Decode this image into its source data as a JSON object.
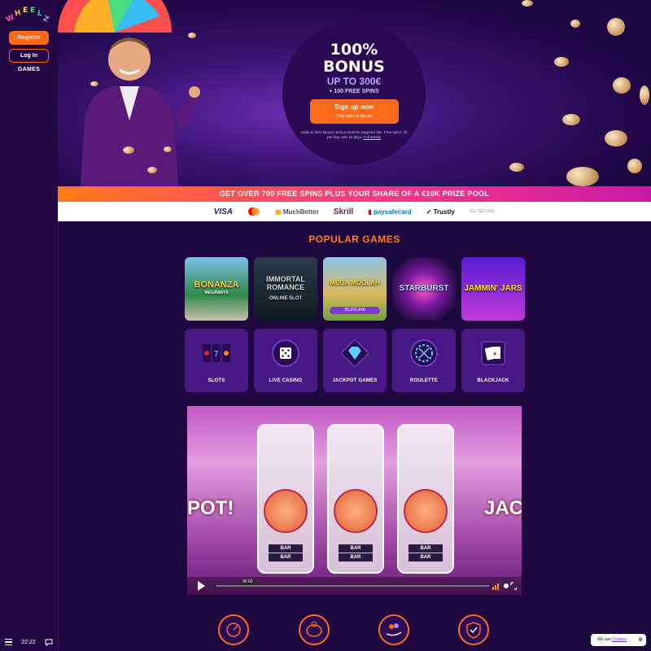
{
  "sidebar": {
    "register_label": "Register",
    "login_label": "Log In",
    "games_label": "GAMES",
    "time": "22:22"
  },
  "hero": {
    "bonus_title_line1": "100%",
    "bonus_title_line2": "BONUS",
    "bonus_up_to": "UP TO 300€",
    "free_spins": "+ 100 FREE SPINS",
    "signup_label": "Sign up now",
    "signup_sub": "Only takes a minute",
    "terms": "Valid on first deposit. Bonus must be wagered 35x. Free spins: 10 per day over 10 days.",
    "terms_link": "Full details"
  },
  "promo_banner": "GET OVER 700 FREE SPINS PLUS YOUR SHARE OF A €10K PRIZE POOL",
  "payments": [
    "VISA",
    "",
    "MuchBetter",
    "Skrill",
    "paysafecard",
    "Trustly",
    "SSL SECURE"
  ],
  "popular_games": {
    "title": "POPULAR GAMES",
    "games": [
      {
        "name": "BONANZA",
        "sub": "MEGAWAYS"
      },
      {
        "name": "IMMORTAL ROMANCE",
        "sub": "ONLINE SLOT"
      },
      {
        "name": "MEGA MOOLAH",
        "sub": "€5,252,440"
      },
      {
        "name": "STARBURST",
        "sub": ""
      },
      {
        "name": "JAMMIN' JARS",
        "sub": ""
      }
    ]
  },
  "categories": [
    {
      "label": "SLOTS",
      "icon": "slots-icon"
    },
    {
      "label": "LIVE CASINO",
      "icon": "dice-icon"
    },
    {
      "label": "JACKPOT GAMES",
      "icon": "diamond-icon"
    },
    {
      "label": "ROULETTE",
      "icon": "roulette-icon"
    },
    {
      "label": "BLACKJACK",
      "icon": "cards-icon"
    }
  ],
  "video": {
    "reel_label": "BAR",
    "left_label": "POT!",
    "right_label": "JAC",
    "time_display": "00:00"
  },
  "cookie": {
    "text": "We use",
    "link": "Cookies"
  },
  "colors": {
    "accent": "#ff6a1a",
    "background": "#1f0840",
    "sidebar": "#230a45",
    "tile": "#461884"
  }
}
